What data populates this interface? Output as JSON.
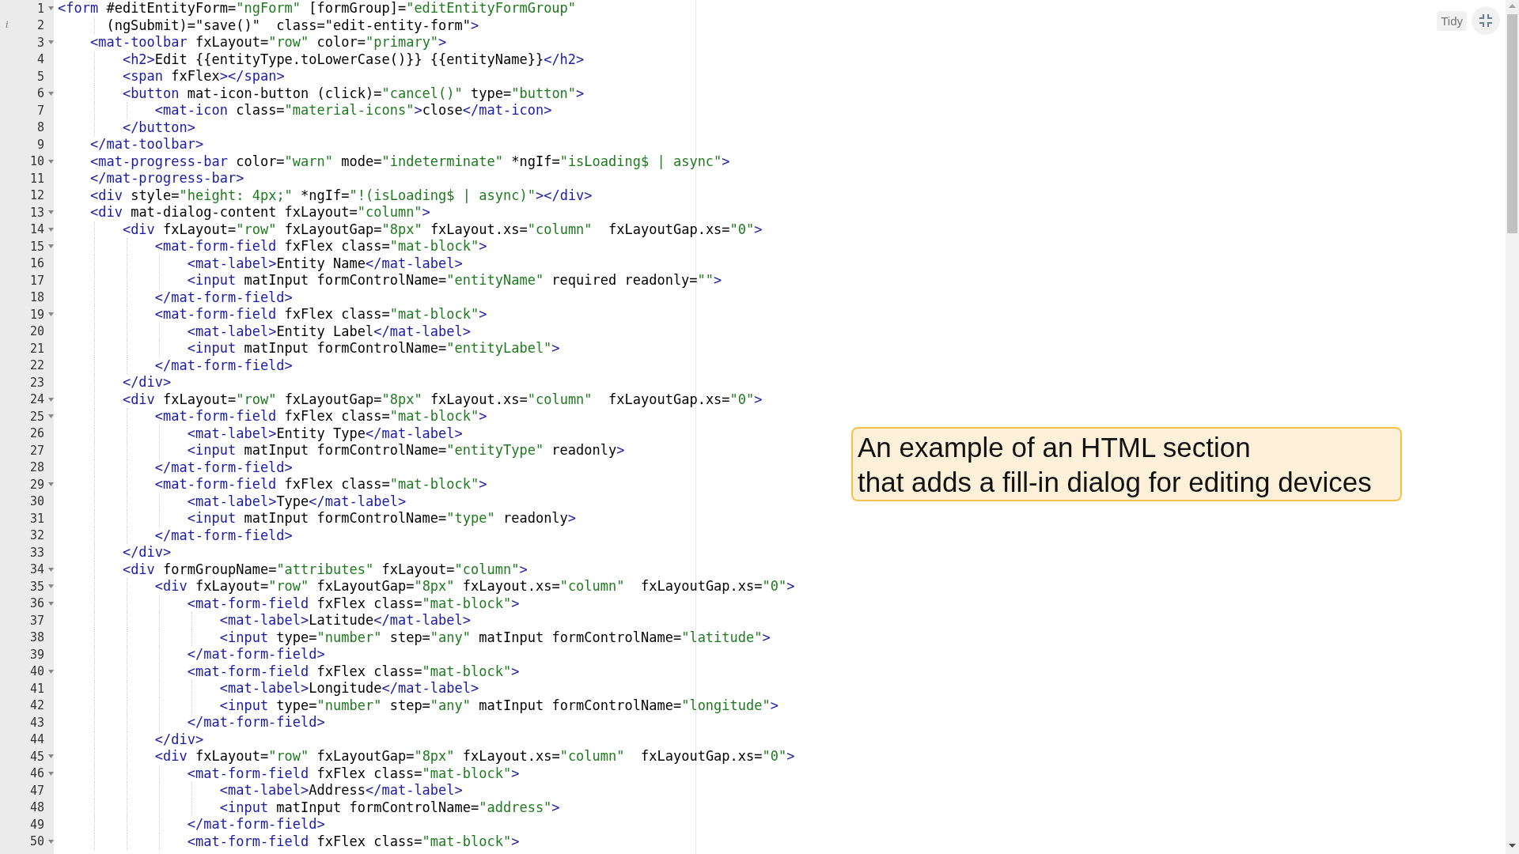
{
  "editor": {
    "lines": [
      {
        "number": "1",
        "foldable": true,
        "code": "<form #editEntityForm=\"ngForm\" [formGroup]=\"editEntityFormGroup\""
      },
      {
        "number": "2",
        "foldable": false,
        "info": "i",
        "code": "      (ngSubmit)=\"save()\"  class=\"edit-entity-form\">"
      },
      {
        "number": "3",
        "foldable": true,
        "code": "    <mat-toolbar fxLayout=\"row\" color=\"primary\">"
      },
      {
        "number": "4",
        "foldable": false,
        "code": "        <h2>Edit {{entityType.toLowerCase()}} {{entityName}}</h2>"
      },
      {
        "number": "5",
        "foldable": false,
        "code": "        <span fxFlex></span>"
      },
      {
        "number": "6",
        "foldable": true,
        "code": "        <button mat-icon-button (click)=\"cancel()\" type=\"button\">"
      },
      {
        "number": "7",
        "foldable": false,
        "code": "            <mat-icon class=\"material-icons\">close</mat-icon>"
      },
      {
        "number": "8",
        "foldable": false,
        "code": "        </button>"
      },
      {
        "number": "9",
        "foldable": false,
        "code": "    </mat-toolbar>"
      },
      {
        "number": "10",
        "foldable": true,
        "code": "    <mat-progress-bar color=\"warn\" mode=\"indeterminate\" *ngIf=\"isLoading$ | async\">"
      },
      {
        "number": "11",
        "foldable": false,
        "code": "    </mat-progress-bar>"
      },
      {
        "number": "12",
        "foldable": false,
        "code": "    <div style=\"height: 4px;\" *ngIf=\"!(isLoading$ | async)\"></div>"
      },
      {
        "number": "13",
        "foldable": true,
        "code": "    <div mat-dialog-content fxLayout=\"column\">"
      },
      {
        "number": "14",
        "foldable": true,
        "code": "        <div fxLayout=\"row\" fxLayoutGap=\"8px\" fxLayout.xs=\"column\"  fxLayoutGap.xs=\"0\">"
      },
      {
        "number": "15",
        "foldable": true,
        "code": "            <mat-form-field fxFlex class=\"mat-block\">"
      },
      {
        "number": "16",
        "foldable": false,
        "code": "                <mat-label>Entity Name</mat-label>"
      },
      {
        "number": "17",
        "foldable": false,
        "code": "                <input matInput formControlName=\"entityName\" required readonly=\"\">"
      },
      {
        "number": "18",
        "foldable": false,
        "code": "            </mat-form-field>"
      },
      {
        "number": "19",
        "foldable": true,
        "code": "            <mat-form-field fxFlex class=\"mat-block\">"
      },
      {
        "number": "20",
        "foldable": false,
        "code": "                <mat-label>Entity Label</mat-label>"
      },
      {
        "number": "21",
        "foldable": false,
        "code": "                <input matInput formControlName=\"entityLabel\">"
      },
      {
        "number": "22",
        "foldable": false,
        "code": "            </mat-form-field>"
      },
      {
        "number": "23",
        "foldable": false,
        "code": "        </div>"
      },
      {
        "number": "24",
        "foldable": true,
        "code": "        <div fxLayout=\"row\" fxLayoutGap=\"8px\" fxLayout.xs=\"column\"  fxLayoutGap.xs=\"0\">"
      },
      {
        "number": "25",
        "foldable": true,
        "code": "            <mat-form-field fxFlex class=\"mat-block\">"
      },
      {
        "number": "26",
        "foldable": false,
        "code": "                <mat-label>Entity Type</mat-label>"
      },
      {
        "number": "27",
        "foldable": false,
        "code": "                <input matInput formControlName=\"entityType\" readonly>"
      },
      {
        "number": "28",
        "foldable": false,
        "code": "            </mat-form-field>"
      },
      {
        "number": "29",
        "foldable": true,
        "code": "            <mat-form-field fxFlex class=\"mat-block\">"
      },
      {
        "number": "30",
        "foldable": false,
        "code": "                <mat-label>Type</mat-label>"
      },
      {
        "number": "31",
        "foldable": false,
        "code": "                <input matInput formControlName=\"type\" readonly>"
      },
      {
        "number": "32",
        "foldable": false,
        "code": "            </mat-form-field>"
      },
      {
        "number": "33",
        "foldable": false,
        "code": "        </div>"
      },
      {
        "number": "34",
        "foldable": true,
        "code": "        <div formGroupName=\"attributes\" fxLayout=\"column\">"
      },
      {
        "number": "35",
        "foldable": true,
        "code": "            <div fxLayout=\"row\" fxLayoutGap=\"8px\" fxLayout.xs=\"column\"  fxLayoutGap.xs=\"0\">"
      },
      {
        "number": "36",
        "foldable": true,
        "code": "                <mat-form-field fxFlex class=\"mat-block\">"
      },
      {
        "number": "37",
        "foldable": false,
        "code": "                    <mat-label>Latitude</mat-label>"
      },
      {
        "number": "38",
        "foldable": false,
        "code": "                    <input type=\"number\" step=\"any\" matInput formControlName=\"latitude\">"
      },
      {
        "number": "39",
        "foldable": false,
        "code": "                </mat-form-field>"
      },
      {
        "number": "40",
        "foldable": true,
        "code": "                <mat-form-field fxFlex class=\"mat-block\">"
      },
      {
        "number": "41",
        "foldable": false,
        "code": "                    <mat-label>Longitude</mat-label>"
      },
      {
        "number": "42",
        "foldable": false,
        "code": "                    <input type=\"number\" step=\"any\" matInput formControlName=\"longitude\">"
      },
      {
        "number": "43",
        "foldable": false,
        "code": "                </mat-form-field>"
      },
      {
        "number": "44",
        "foldable": false,
        "code": "            </div>"
      },
      {
        "number": "45",
        "foldable": true,
        "code": "            <div fxLayout=\"row\" fxLayoutGap=\"8px\" fxLayout.xs=\"column\"  fxLayoutGap.xs=\"0\">"
      },
      {
        "number": "46",
        "foldable": true,
        "code": "                <mat-form-field fxFlex class=\"mat-block\">"
      },
      {
        "number": "47",
        "foldable": false,
        "code": "                    <mat-label>Address</mat-label>"
      },
      {
        "number": "48",
        "foldable": false,
        "code": "                    <input matInput formControlName=\"address\">"
      },
      {
        "number": "49",
        "foldable": false,
        "code": "                </mat-form-field>"
      },
      {
        "number": "50",
        "foldable": true,
        "code": "                <mat-form-field fxFlex class=\"mat-block\">"
      }
    ]
  },
  "toolbar": {
    "tidy_button": "Tidy"
  },
  "callout": {
    "text": "An example of an HTML section\nthat adds a fill-in dialog for editing devices"
  }
}
